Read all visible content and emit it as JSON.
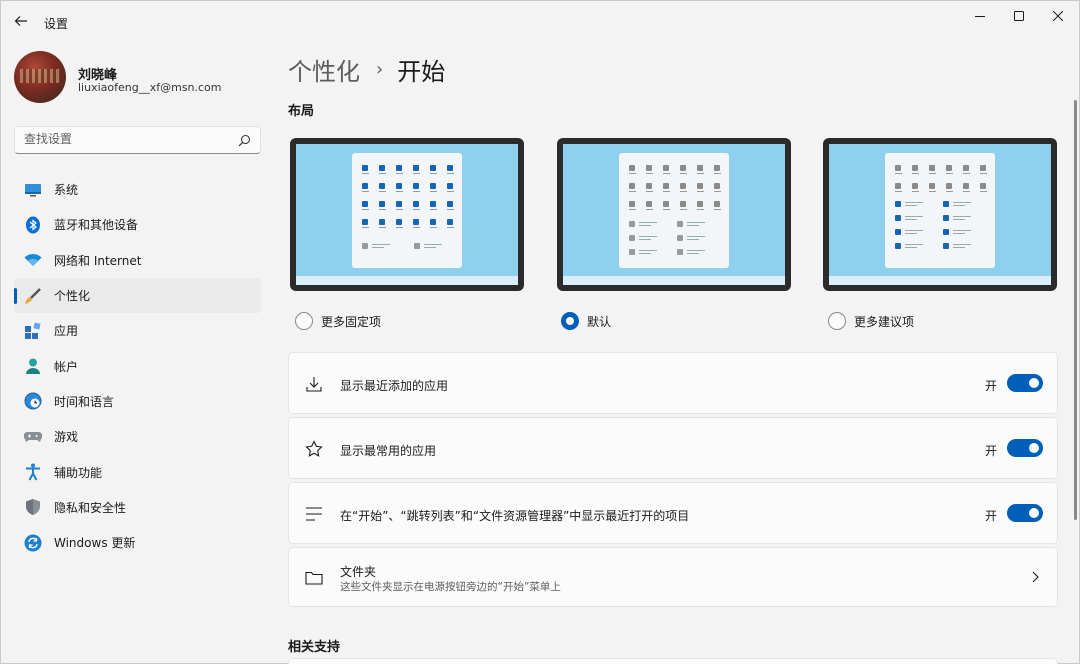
{
  "window": {
    "title": "设置"
  },
  "user": {
    "name": "刘晓峰",
    "email": "liuxiaofeng__xf@msn.com"
  },
  "search": {
    "placeholder": "查找设置"
  },
  "sidebar": {
    "items": [
      {
        "label": "系统",
        "icon": "monitor-icon"
      },
      {
        "label": "蓝牙和其他设备",
        "icon": "bluetooth-icon"
      },
      {
        "label": "网络和 Internet",
        "icon": "wifi-icon"
      },
      {
        "label": "个性化",
        "icon": "brush-icon",
        "active": true
      },
      {
        "label": "应用",
        "icon": "apps-icon"
      },
      {
        "label": "帐户",
        "icon": "person-icon"
      },
      {
        "label": "时间和语言",
        "icon": "globe-clock-icon"
      },
      {
        "label": "游戏",
        "icon": "gamepad-icon"
      },
      {
        "label": "辅助功能",
        "icon": "accessibility-icon"
      },
      {
        "label": "隐私和安全性",
        "icon": "shield-icon"
      },
      {
        "label": "Windows 更新",
        "icon": "update-icon"
      }
    ]
  },
  "breadcrumb": {
    "parent": "个性化",
    "separator": "›",
    "current": "开始"
  },
  "layout": {
    "title": "布局",
    "options": [
      {
        "label": "更多固定项",
        "selected": false
      },
      {
        "label": "默认",
        "selected": true
      },
      {
        "label": "更多建议项",
        "selected": false
      }
    ]
  },
  "settings": {
    "recent_apps": {
      "label": "显示最近添加的应用",
      "state": "开",
      "on": true,
      "icon": "download-icon"
    },
    "most_used": {
      "label": "显示最常用的应用",
      "state": "开",
      "on": true,
      "icon": "star-icon"
    },
    "recent_items": {
      "label": "在“开始”、“跳转列表”和“文件资源管理器”中显示最近打开的项目",
      "state": "开",
      "on": true,
      "icon": "list-icon"
    },
    "folders": {
      "label": "文件夹",
      "description": "这些文件夹显示在电源按钮旁边的“开始”菜单上",
      "icon": "folder-icon"
    }
  },
  "related": {
    "title": "相关支持"
  },
  "colors": {
    "accent": "#005fb8",
    "background": "#f3f3f3",
    "card": "#fbfbfb"
  }
}
